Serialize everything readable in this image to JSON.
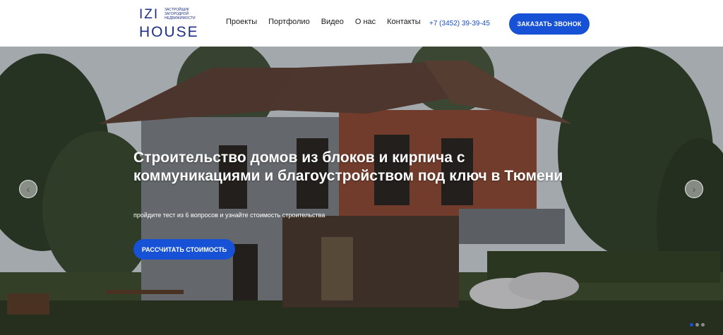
{
  "header": {
    "logo": {
      "line1": "IZI",
      "line2": "HOUSE",
      "tagline": "ЗАСТРОЙЩИК ЗАГОРОДНОЙ НЕДВИЖИМОСТИ"
    },
    "nav": [
      {
        "label": "Проекты"
      },
      {
        "label": "Портфолио"
      },
      {
        "label": "Видео"
      },
      {
        "label": "О нас"
      },
      {
        "label": "Контакты"
      }
    ],
    "phone": "+7 (3452) 39-39-45",
    "cta_label": "ЗАКАЗАТЬ ЗВОНОК"
  },
  "hero": {
    "title": "Строительство домов из блоков и кирпича с коммуникациями и благоустройством под ключ в Тюмени",
    "subtitle": "пройдите тест из 6 вопросов и узнайте стоимость строительства",
    "button_label": "РАССЧИТАТЬ СТОИМОСТЬ",
    "prev_icon": "chevron-left-icon",
    "next_icon": "chevron-right-icon",
    "slides_count": 3,
    "active_slide": 1
  },
  "colors": {
    "brand_blue": "#1752d6",
    "logo_navy": "#1f2f86",
    "phone_blue": "#1c4fbf"
  }
}
